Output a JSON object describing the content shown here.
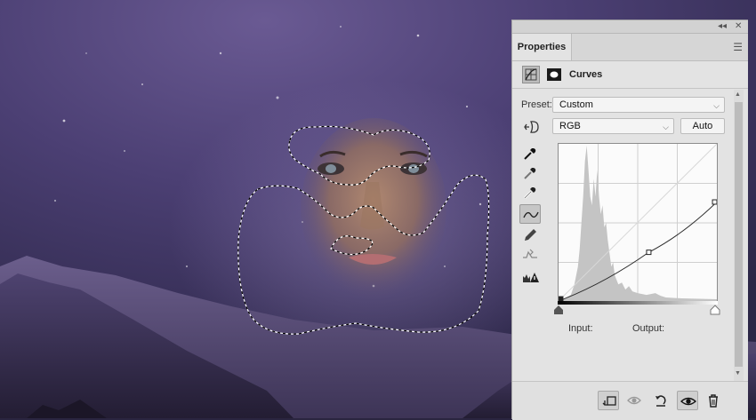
{
  "canvas": {
    "description_icon": "night-sky-portrait"
  },
  "panel": {
    "tab_label": "Properties",
    "adjustment_title": "Curves",
    "preset_label": "Preset:",
    "preset_value": "Custom",
    "channel_value": "RGB",
    "auto_label": "Auto",
    "input_label": "Input:",
    "output_label": "Output:"
  },
  "curve": {
    "points": [
      [
        0,
        0
      ],
      [
        0.57,
        0.31
      ],
      [
        1,
        0.63
      ]
    ]
  },
  "icons": {
    "tools": [
      "sample-black-point-icon",
      "sample-gray-point-icon",
      "sample-white-point-icon",
      "curve-points-icon",
      "pencil-icon",
      "smooth-icon",
      "clipping-warning-icon"
    ],
    "bottom": [
      "clip-to-layer-icon",
      "view-previous-icon",
      "reset-icon",
      "visibility-icon",
      "delete-icon"
    ]
  },
  "colors": {
    "accent_sky": "#5a4c86",
    "panel_bg": "#e3e3e3"
  }
}
